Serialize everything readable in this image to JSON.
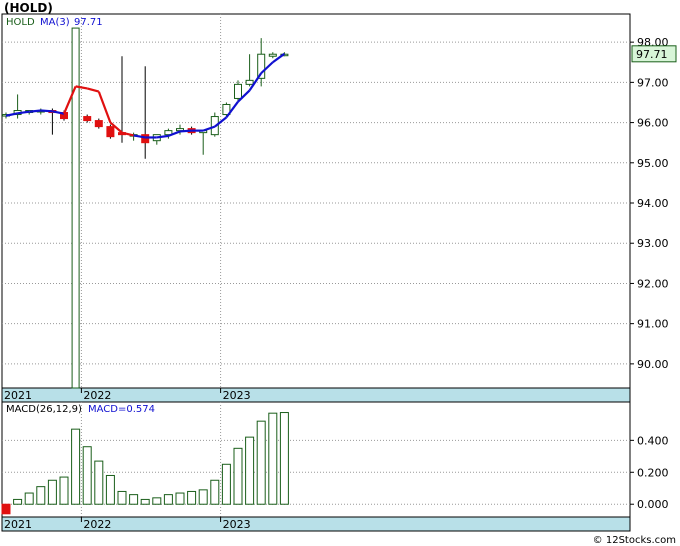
{
  "title": "(HOLD)",
  "copyright": "© 12Stocks.com",
  "colors": {
    "up": "#1a5e1a",
    "down": "#e01010",
    "ma_up": "#1010d0",
    "ma_down": "#e01010",
    "axis_band": "#b8e0e8",
    "last_label_bg": "#d8f5d8",
    "macd_bar": "#1a5e1a"
  },
  "chart_data": [
    {
      "type": "candlestick",
      "legend": {
        "symbol": "HOLD",
        "ma_label": "MA(3)",
        "ma_value": "97.71"
      },
      "last_price_label": "97.71",
      "ylim": [
        89.4,
        98.7
      ],
      "yticks": [
        "98.00",
        "97.00",
        "96.00",
        "95.00",
        "94.00",
        "93.00",
        "92.00",
        "91.00",
        "90.00"
      ],
      "ytick_values": [
        98,
        97,
        96,
        95,
        94,
        93,
        92,
        91,
        90
      ],
      "xlabels": [
        "2021",
        "2022",
        "2023"
      ],
      "xlabel_index": [
        0,
        7,
        19
      ],
      "candles": [
        {
          "o": 96.2,
          "h": 96.25,
          "l": 96.1,
          "c": 96.2
        },
        {
          "o": 96.2,
          "h": 96.7,
          "l": 96.1,
          "c": 96.3
        },
        {
          "o": 96.25,
          "h": 96.3,
          "l": 96.2,
          "c": 96.3
        },
        {
          "o": 96.3,
          "h": 96.35,
          "l": 96.2,
          "c": 96.3
        },
        {
          "o": 96.3,
          "h": 96.35,
          "l": 95.7,
          "c": 96.25
        },
        {
          "o": 96.25,
          "h": 96.3,
          "l": 96.05,
          "c": 96.1
        },
        {
          "o": 89.4,
          "h": 98.35,
          "l": 89.4,
          "c": 98.35
        },
        {
          "o": 96.15,
          "h": 96.2,
          "l": 96.0,
          "c": 96.05
        },
        {
          "o": 96.05,
          "h": 96.1,
          "l": 95.85,
          "c": 95.9
        },
        {
          "o": 95.9,
          "h": 95.95,
          "l": 95.6,
          "c": 95.65
        },
        {
          "o": 95.75,
          "h": 97.65,
          "l": 95.5,
          "c": 95.7
        },
        {
          "o": 95.7,
          "h": 95.75,
          "l": 95.55,
          "c": 95.7
        },
        {
          "o": 95.7,
          "h": 97.4,
          "l": 95.1,
          "c": 95.5
        },
        {
          "o": 95.55,
          "h": 95.7,
          "l": 95.45,
          "c": 95.7
        },
        {
          "o": 95.7,
          "h": 95.85,
          "l": 95.6,
          "c": 95.8
        },
        {
          "o": 95.8,
          "h": 95.95,
          "l": 95.7,
          "c": 95.85
        },
        {
          "o": 95.85,
          "h": 95.9,
          "l": 95.7,
          "c": 95.75
        },
        {
          "o": 95.75,
          "h": 95.8,
          "l": 95.2,
          "c": 95.8
        },
        {
          "o": 95.7,
          "h": 96.25,
          "l": 95.65,
          "c": 96.15
        },
        {
          "o": 96.2,
          "h": 96.5,
          "l": 96.15,
          "c": 96.45
        },
        {
          "o": 96.6,
          "h": 97.05,
          "l": 96.55,
          "c": 96.95
        },
        {
          "o": 96.95,
          "h": 97.7,
          "l": 96.9,
          "c": 97.05
        },
        {
          "o": 97.1,
          "h": 98.1,
          "l": 96.9,
          "c": 97.7
        },
        {
          "o": 97.65,
          "h": 97.75,
          "l": 97.6,
          "c": 97.7
        },
        {
          "o": 97.7,
          "h": 97.75,
          "l": 97.65,
          "c": 97.7
        }
      ],
      "ma": [
        96.17,
        96.23,
        96.27,
        96.3,
        96.28,
        96.22,
        96.9,
        96.85,
        96.77,
        96.0,
        95.75,
        95.68,
        95.63,
        95.63,
        95.67,
        95.78,
        95.8,
        95.8,
        95.9,
        96.13,
        96.52,
        96.8,
        97.23,
        97.5,
        97.71
      ],
      "ma_color_flags": [
        "u",
        "u",
        "u",
        "u",
        "u",
        "u",
        "d",
        "d",
        "d",
        "d",
        "d",
        "d",
        "u",
        "u",
        "u",
        "u",
        "u",
        "u",
        "u",
        "u",
        "u",
        "u",
        "u",
        "u",
        "u"
      ]
    },
    {
      "type": "bar",
      "legend": {
        "label": "MACD(26,12,9)",
        "value_label": "MACD=0.574"
      },
      "ylim": [
        -0.08,
        0.64
      ],
      "yticks": [
        "0.400",
        "0.200",
        "0.000"
      ],
      "ytick_values": [
        0.4,
        0.2,
        0.0
      ],
      "xlabels": [
        "2021",
        "2022",
        "2023"
      ],
      "xlabel_index": [
        0,
        7,
        19
      ],
      "values": [
        -0.06,
        0.03,
        0.07,
        0.11,
        0.15,
        0.17,
        0.47,
        0.36,
        0.27,
        0.18,
        0.08,
        0.06,
        0.03,
        0.04,
        0.06,
        0.07,
        0.08,
        0.09,
        0.15,
        0.25,
        0.35,
        0.42,
        0.52,
        0.57,
        0.574
      ]
    }
  ]
}
